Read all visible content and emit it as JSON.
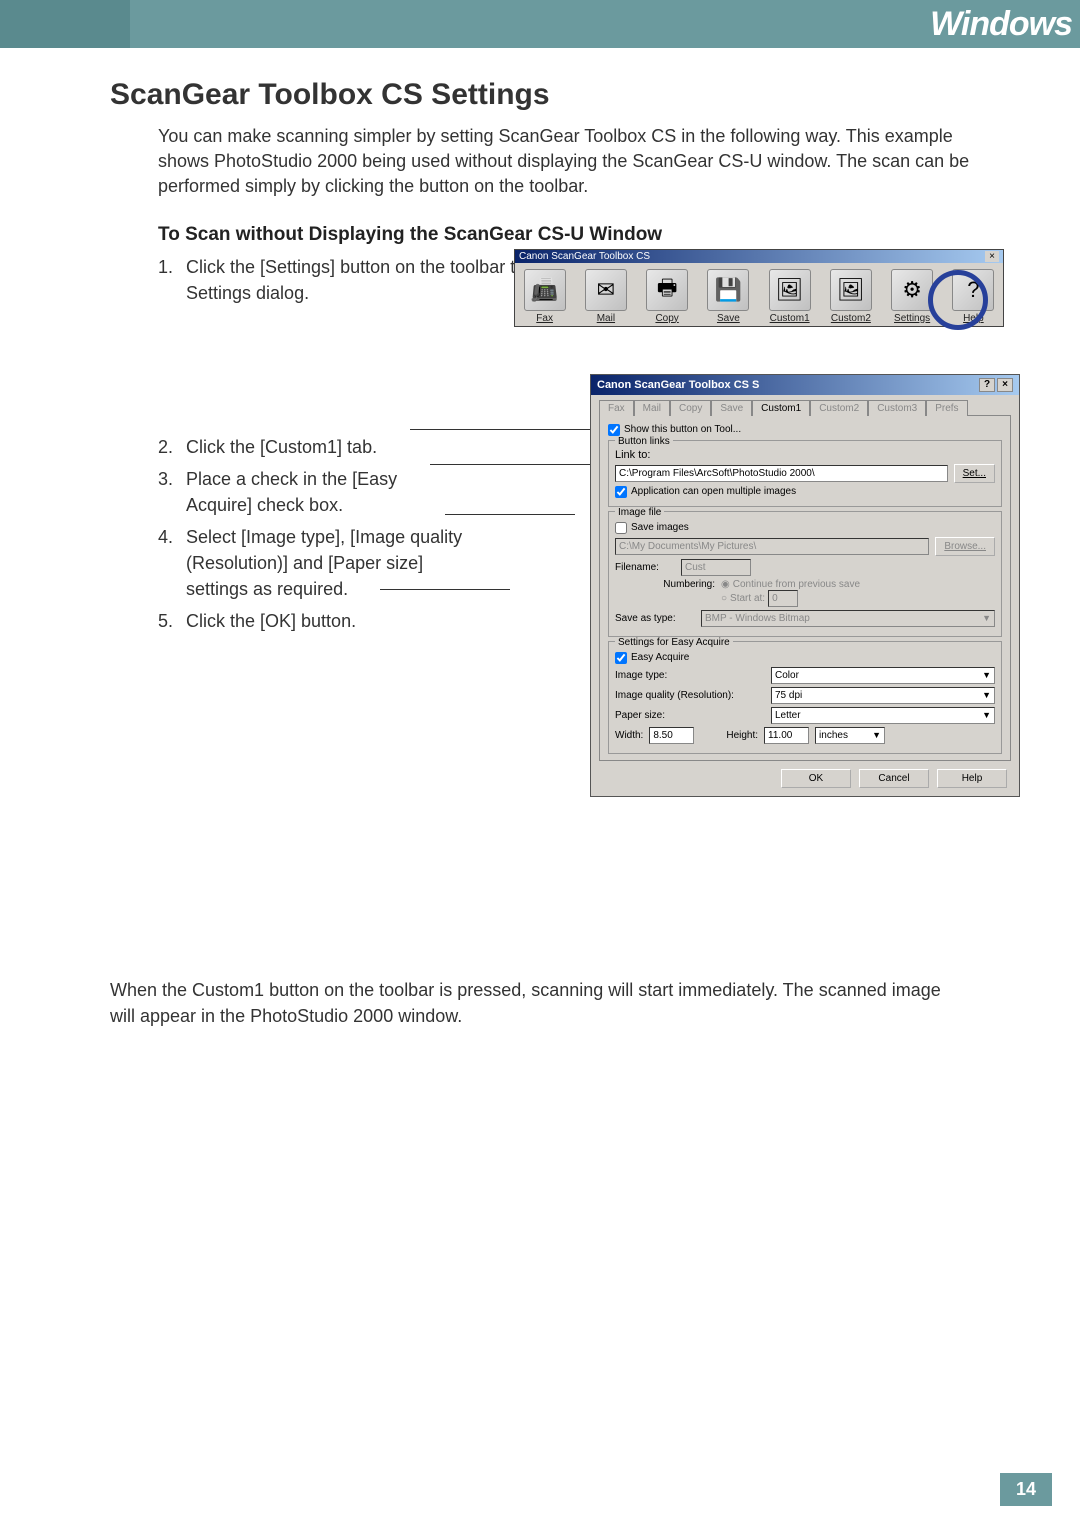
{
  "header": {
    "badge": "Windows"
  },
  "page": {
    "title": "ScanGear Toolbox CS Settings",
    "intro": "You can make scanning simpler by setting ScanGear Toolbox CS in the following way. This example shows PhotoStudio 2000 being used without displaying the ScanGear CS-U window. The scan can be performed simply by clicking the button on the toolbar.",
    "subhead": "To Scan without Displaying the ScanGear CS-U Window",
    "steps": [
      {
        "n": "1.",
        "t": "Click the [Settings] button on the toolbar to display the ScanGear Toolbox CS Settings dialog."
      },
      {
        "n": "2.",
        "t": "Click the [Custom1] tab."
      },
      {
        "n": "3.",
        "t": "Place a check in the [Easy Acquire] check box."
      },
      {
        "n": "4.",
        "t": "Select [Image type], [Image quality (Resolution)] and [Paper size] settings as required."
      },
      {
        "n": "5.",
        "t": "Click the [OK] button."
      }
    ],
    "outro": "When the Custom1 button on the toolbar is pressed, scanning will start immediately. The scanned image will appear in the PhotoStudio 2000 window.",
    "number": "14"
  },
  "toolbox": {
    "title": "Canon ScanGear Toolbox CS",
    "close": "×",
    "buttons": [
      {
        "label": "Fax",
        "glyph": "📠"
      },
      {
        "label": "Mail",
        "glyph": "✉"
      },
      {
        "label": "Copy",
        "glyph": "🖶"
      },
      {
        "label": "Save",
        "glyph": "💾"
      },
      {
        "label": "Custom1",
        "glyph": "🖼"
      },
      {
        "label": "Custom2",
        "glyph": "🖼"
      },
      {
        "label": "Settings",
        "glyph": "⚙"
      },
      {
        "label": "Help",
        "glyph": "?"
      }
    ]
  },
  "dialog": {
    "title": "Canon ScanGear Toolbox CS S",
    "help_btn": "?",
    "close_btn": "×",
    "tabs": [
      "Fax",
      "Mail",
      "Copy",
      "Save",
      "Custom1",
      "Custom2",
      "Custom3",
      "Prefs"
    ],
    "active_tab": "Custom1",
    "show_button_label": "Show this button on Tool...",
    "buttonlinks_title": "Button links",
    "linkto_label": "Link to:",
    "linkto_value": "C:\\Program Files\\ArcSoft\\PhotoStudio 2000\\",
    "set_btn": "Set...",
    "app_multi_label": "Application can open multiple images",
    "imagefile_title": "Image file",
    "save_images_label": "Save images",
    "save_path": "C:\\My Documents\\My Pictures\\",
    "browse_btn": "Browse...",
    "filename_label": "Filename:",
    "filename_value": "Cust",
    "numbering_label": "Numbering:",
    "numbering_opt1": "Continue from previous save",
    "numbering_opt2": "Start at:",
    "numbering_start": "0",
    "saveastype_label": "Save as type:",
    "saveastype_value": "BMP - Windows Bitmap",
    "easy_title": "Settings for Easy Acquire",
    "easy_checkbox": "Easy Acquire",
    "imagetype_label": "Image type:",
    "imagetype_value": "Color",
    "imagequality_label": "Image quality (Resolution):",
    "imagequality_value": "75 dpi",
    "papersize_label": "Paper size:",
    "papersize_value": "Letter",
    "width_label": "Width:",
    "width_value": "8.50",
    "height_label": "Height:",
    "height_value": "11.00",
    "units_value": "inches",
    "ok_btn": "OK",
    "cancel_btn": "Cancel",
    "help_btn2": "Help"
  }
}
